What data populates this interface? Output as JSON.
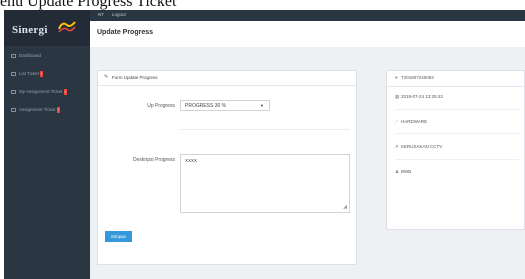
{
  "caption": "enu Update Progress Ticket",
  "app": {
    "brand": "Sinergi"
  },
  "topbar": {
    "items": [
      "NT",
      "Logout"
    ]
  },
  "sidebar": {
    "items": [
      {
        "label": "Dashboard",
        "icon": "grid-icon",
        "badge": ""
      },
      {
        "label": "List Ticket",
        "icon": "list-icon",
        "badge": "!"
      },
      {
        "label": "My Assignment Ticket",
        "icon": "list-icon",
        "badge": "!"
      },
      {
        "label": "Assignment Ticket",
        "icon": "list-icon",
        "badge": "!"
      }
    ]
  },
  "header": {
    "title": "Update Progress"
  },
  "form": {
    "panel_title": "Form Update Progress",
    "progress_label": "Up Progress",
    "progress_value": "PROGRESS 30 %",
    "description_label": "Deskripsi Progress",
    "description_value": "XXXX",
    "submit_label": "Simpan"
  },
  "ticket_info": {
    "ticket_no": "T201807240063",
    "datetime": "2018-07-24 13:25:43",
    "category": "HARDWARE",
    "subject": "KERUSAKAN CCTV",
    "user": "BWB"
  },
  "colors": {
    "sidebar": "#2b3643",
    "accent": "#3598dc",
    "badge": "#e7473c"
  }
}
